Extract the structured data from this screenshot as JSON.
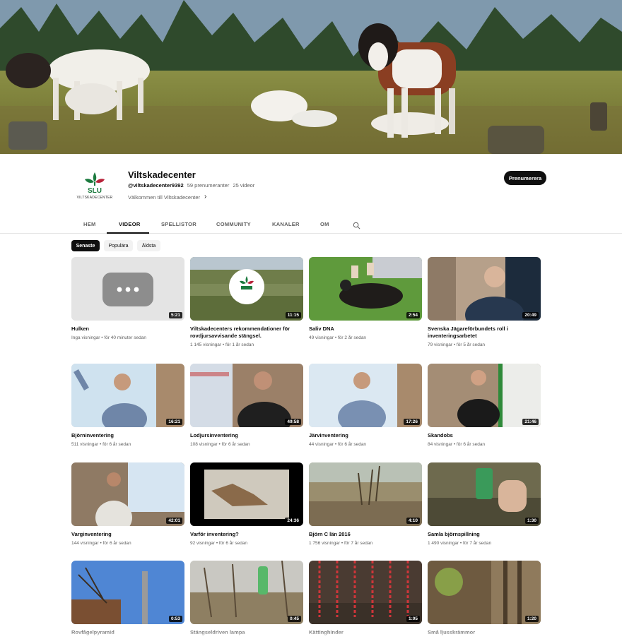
{
  "channel": {
    "name": "Viltskadecenter",
    "handle": "@viltskadecenter9392",
    "subscribers": "59 prenumeranter",
    "video_count": "25 videor",
    "description": "Välkommen till Viltskadecenter",
    "logo_text": "SLU",
    "logo_caption": "VILTSKADECENTER",
    "subscribe_label": "Prenumerera"
  },
  "tabs": [
    {
      "label": "HEM"
    },
    {
      "label": "VIDEOR",
      "active": true
    },
    {
      "label": "SPELLISTOR"
    },
    {
      "label": "COMMUNITY"
    },
    {
      "label": "KANALER"
    },
    {
      "label": "OM"
    }
  ],
  "chips": [
    {
      "label": "Senaste",
      "selected": true
    },
    {
      "label": "Populära"
    },
    {
      "label": "Äldsta"
    }
  ],
  "videos": [
    {
      "title": "Hulken",
      "meta": "Inga visningar • för 40 minuter sedan",
      "duration": "5:21"
    },
    {
      "title": "Viltskadecenters rekommendationer för rovdjursavvisande stängsel.",
      "meta": "1 145 visningar • för 1 år sedan",
      "duration": "11:15"
    },
    {
      "title": "Saliv DNA",
      "meta": "49 visningar • för 2 år sedan",
      "duration": "2:54"
    },
    {
      "title": "Svenska Jägareförbundets roll i inventeringsarbetet",
      "meta": "79 visningar • för 5 år sedan",
      "duration": "20:49"
    },
    {
      "title": "Björninventering",
      "meta": "511 visningar • för 6 år sedan",
      "duration": "16:21"
    },
    {
      "title": "Lodjursinventering",
      "meta": "108 visningar • för 6 år sedan",
      "duration": "49:58"
    },
    {
      "title": "Järvinventering",
      "meta": "44 visningar • för 6 år sedan",
      "duration": "17:26"
    },
    {
      "title": "Skandobs",
      "meta": "84 visningar • för 6 år sedan",
      "duration": "21:46"
    },
    {
      "title": "Varginventering",
      "meta": "144 visningar • för 6 år sedan",
      "duration": "42:01"
    },
    {
      "title": "Varför inventering?",
      "meta": "92 visningar • för 6 år sedan",
      "duration": "24:36"
    },
    {
      "title": "Björn C län 2016",
      "meta": "1 756 visningar • för 7 år sedan",
      "duration": "4:10"
    },
    {
      "title": "Samla björnspillning",
      "meta": "1 490 visningar • för 7 år sedan",
      "duration": "1:30"
    },
    {
      "title": "Rovfågelpyramid",
      "meta": "",
      "duration": "0:53"
    },
    {
      "title": "Stängseldriven lampa",
      "meta": "",
      "duration": "0:45"
    },
    {
      "title": "Kättinghinder",
      "meta": "",
      "duration": "1:05"
    },
    {
      "title": "Små ljusskrämmor",
      "meta": "",
      "duration": "1:20"
    }
  ],
  "icons": {
    "search": "search-icon",
    "chevron": "chevron-right-icon",
    "more": "more-dots-icon"
  },
  "colors": {
    "subscribe_bg": "#0f0f0f",
    "slu_green": "#1b7a3e",
    "slu_red": "#b8233a"
  }
}
